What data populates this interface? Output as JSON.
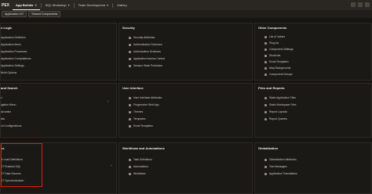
{
  "topbar": {
    "brand": "PEX",
    "tabs": [
      {
        "label": "App Builder",
        "active": true
      },
      {
        "label": "SQL Workshop",
        "active": false
      },
      {
        "label": "Team Development",
        "active": false
      },
      {
        "label": "Gallery",
        "active": false
      }
    ]
  },
  "breadcrumb": [
    "Application 117",
    "Shared Components"
  ],
  "panels": [
    {
      "title": "n Logic",
      "items": [
        "Application Definition",
        "Application Items",
        "Application Processes",
        "Application Computations",
        "Application Settings",
        "Build Options"
      ]
    },
    {
      "title": "Security",
      "items": [
        "Security Attributes",
        "Authentication Schemes",
        "Authorization Schemes",
        "Application Access Control",
        "Session State Protection"
      ]
    },
    {
      "title": "Other Components",
      "items": [
        "List of Values",
        "Plug-ins",
        "Component Settings",
        "Shortcuts",
        "Email Templates",
        "Map Backgrounds",
        "Component Groups"
      ]
    },
    {
      "title": "and Search",
      "items": [
        "s",
        "igation Menu",
        "dcrumbs",
        "ists",
        "ch Configurations"
      ]
    },
    {
      "title": "User Interface",
      "items": [
        "User Interface Attributes",
        "Progressive Web App",
        "Themes",
        "Templates",
        "Email Templates"
      ]
    },
    {
      "title": "Files and Reports",
      "items": [
        "Static Application Files",
        "Static Workspace Files",
        "Report Layouts",
        "Report Queries"
      ]
    },
    {
      "title": "es",
      "items": [
        "le Load Definitions",
        "ST Enabled SQL",
        "ST Data Sources",
        "ST Synchronization"
      ]
    },
    {
      "title": "Workflows and Automations",
      "items": [
        "Task Definitions",
        "Automations",
        "Workflows"
      ]
    },
    {
      "title": "Globalization",
      "items": [
        "Globalization Attributes",
        "Text Messages",
        "Application Translations"
      ]
    }
  ]
}
